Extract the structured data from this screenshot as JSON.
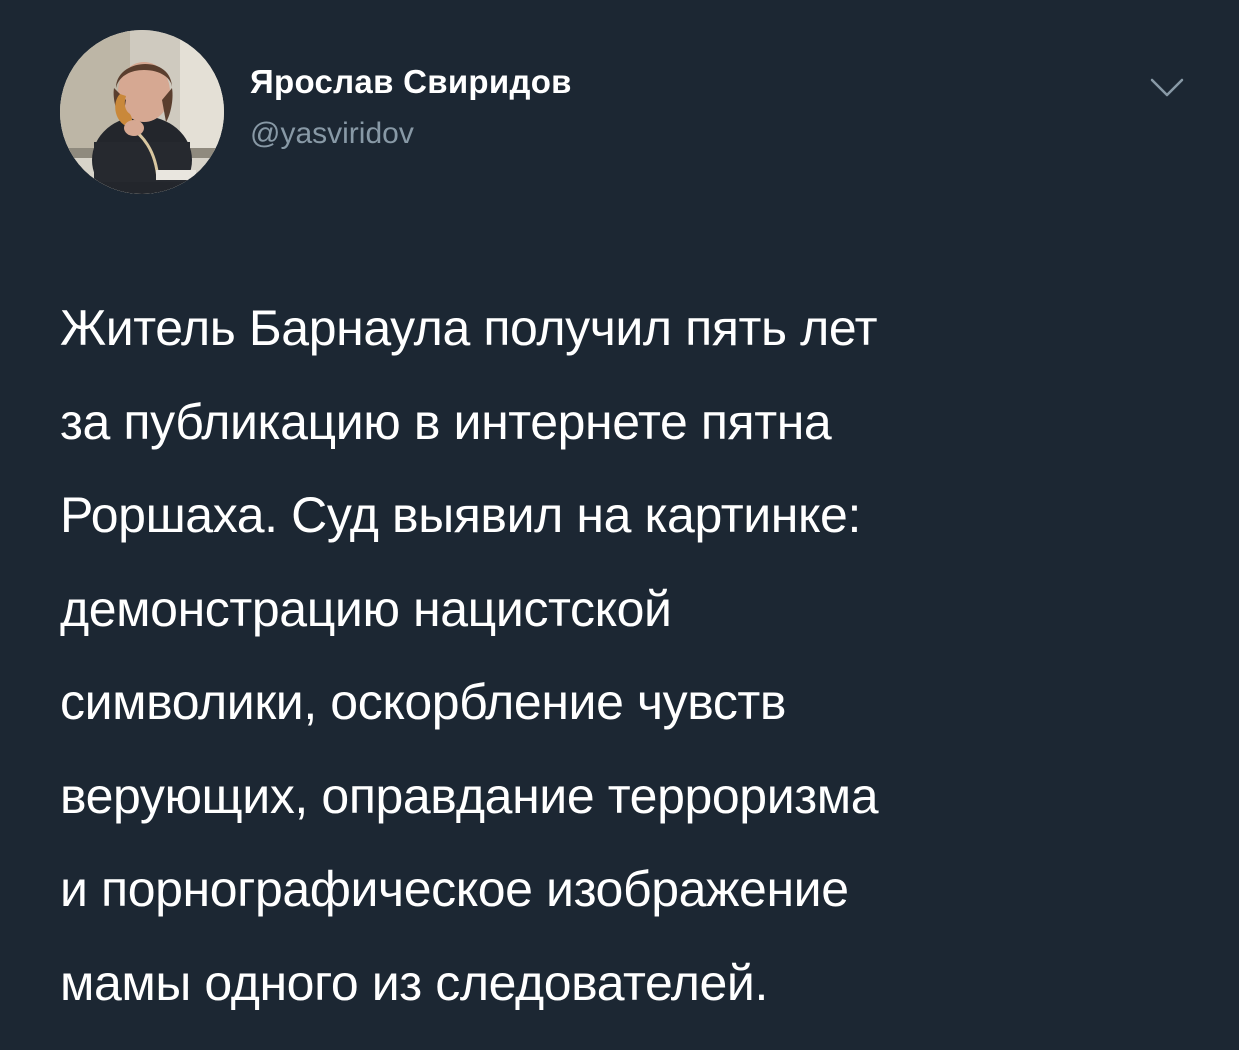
{
  "tweet": {
    "author": {
      "display_name": "Ярослав Свиридов",
      "handle": "@yasviridov",
      "avatar_icon": "profile-photo"
    },
    "menu_icon": "chevron-down-icon",
    "text_lines": [
      "Житель Барнаула получил пять лет",
      "за публикацию в интернете пятна",
      "Роршаха. Суд выявил на картинке:",
      "демонстрацию нацистской",
      "символики, оскорбление чувств",
      "верующих, оправдание терроризма",
      "и порнографическое изображение",
      "мамы одного из следователей."
    ]
  },
  "colors": {
    "background": "#1c2733",
    "primary_text": "#ffffff",
    "secondary_text": "#8899a6"
  }
}
